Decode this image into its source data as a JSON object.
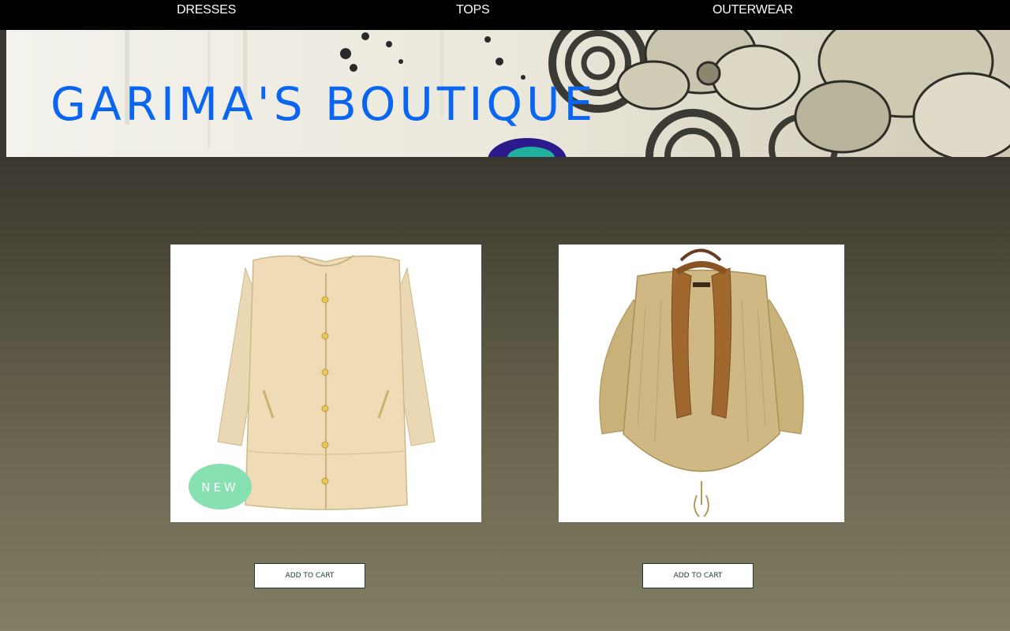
{
  "nav": {
    "items": [
      {
        "label": "DRESSES"
      },
      {
        "label": "TOPS"
      },
      {
        "label": "OUTERWEAR"
      }
    ]
  },
  "banner": {
    "title": "GARIMA'S BOUTIQUE"
  },
  "products": [
    {
      "image_badge": "NEW",
      "button_label": "ADD TO CART"
    },
    {
      "button_label": "ADD TO CART"
    }
  ],
  "colors": {
    "nav_bg": "#000000",
    "title": "#0a66f0",
    "page_bg_top": "#3a3830",
    "page_bg_bottom": "#827d64"
  }
}
